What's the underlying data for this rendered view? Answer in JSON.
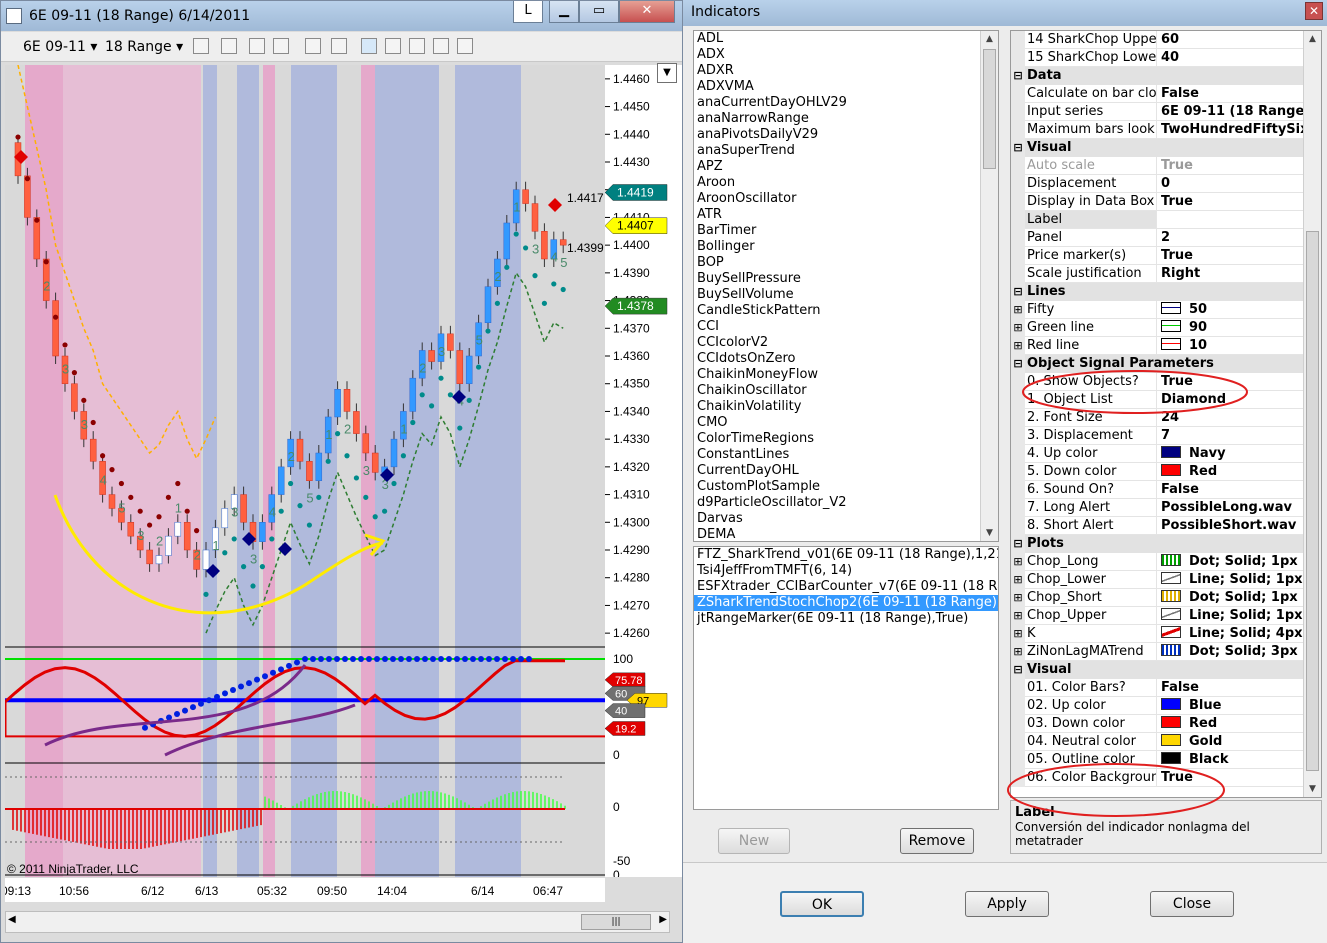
{
  "chart_window": {
    "title": "6E 09-11 (18 Range)  6/14/2011",
    "btn_l": "L",
    "instrument": "6E 09-11",
    "interval": "18 Range",
    "copyright": "© 2011 NinjaTrader, LLC",
    "price_ticks": [
      "1.4460",
      "1.4450",
      "1.4440",
      "1.4430",
      "1.4420",
      "1.4410",
      "1.4400",
      "1.4390",
      "1.4380",
      "1.4370",
      "1.4360",
      "1.4350",
      "1.4340",
      "1.4330",
      "1.4320",
      "1.4310",
      "1.4300",
      "1.4290",
      "1.4280",
      "1.4270",
      "1.4260"
    ],
    "price_markers": [
      {
        "label": "1.4419",
        "color": "#008080",
        "text_color": "#ffffff"
      },
      {
        "label": "1.4407",
        "color": "#ffff00",
        "text_color": "#000000"
      },
      {
        "label": "1.4378",
        "color": "#228b22",
        "text_color": "#ffffff"
      }
    ],
    "price_labels": [
      "1.4417",
      "1.4399"
    ],
    "osc_ticks": [
      "100",
      "0"
    ],
    "osc_markers": [
      {
        "label": "75.78",
        "color": "#e00000",
        "text_color": "#ffffff"
      },
      {
        "label": "60",
        "color": "#707070",
        "text_color": "#ffffff"
      },
      {
        "label": "97",
        "color": "#ffd700",
        "text_color": "#000000"
      },
      {
        "label": "40",
        "color": "#707070",
        "text_color": "#ffffff"
      },
      {
        "label": "19.2",
        "color": "#e00000",
        "text_color": "#ffffff"
      }
    ],
    "hist_ticks": [
      "0",
      "-50",
      "0"
    ],
    "time_labels": [
      "09:13",
      "10:56",
      "6/12",
      "6/13",
      "05:32",
      "09:50",
      "14:04",
      "6/14",
      "06:47"
    ],
    "bar_numbers": [
      "2",
      "3",
      "3",
      "4",
      "5",
      "3",
      "2",
      "1",
      "2",
      "1",
      "3",
      "3",
      "4",
      "2",
      "5",
      "1",
      "2",
      "3",
      "3",
      "1",
      "2",
      "3",
      "4",
      "5",
      "2",
      "1",
      "3",
      "4",
      "5"
    ]
  },
  "dialog": {
    "title": "Indicators",
    "close": "✕",
    "indicators": [
      "ADL",
      "ADX",
      "ADXR",
      "ADXVMA",
      "anaCurrentDayOHLV29",
      "anaNarrowRange",
      "anaPivotsDailyV29",
      "anaSuperTrend",
      "APZ",
      "Aroon",
      "AroonOscillator",
      "ATR",
      "BarTimer",
      "Bollinger",
      "BOP",
      "BuySellPressure",
      "BuySellVolume",
      "CandleStickPattern",
      "CCI",
      "CCIcolorV2",
      "CCIdotsOnZero",
      "ChaikinMoneyFlow",
      "ChaikinOscillator",
      "ChaikinVolatility",
      "CMO",
      "ColorTimeRegions",
      "ConstantLines",
      "CurrentDayOHL",
      "CustomPlotSample",
      "d9ParticleOscillator_V2",
      "Darvas",
      "DEMA"
    ],
    "applied": [
      {
        "label": "FTZ_SharkTrend_v01(6E 09-11 (18 Range),1,21,Ze",
        "selected": false
      },
      {
        "label": "Tsi4JeffFromTMFT(6, 14)",
        "selected": false
      },
      {
        "label": "ESFXtrader_CCIBarCounter_v7(6E 09-11 (18 Range",
        "selected": false
      },
      {
        "label": "ZSharkTrendStochChop2(6E 09-11 (18 Range),3,4,",
        "selected": true
      },
      {
        "label": "jtRangeMarker(6E 09-11 (18 Range),True)",
        "selected": false
      }
    ],
    "new_button": "New",
    "remove_button": "Remove",
    "properties": [
      {
        "kind": "prop",
        "name": "14 SharkChop Upper",
        "value": "60"
      },
      {
        "kind": "prop",
        "name": "15 SharkChop Lower",
        "value": "40"
      },
      {
        "kind": "cat",
        "name": "Data"
      },
      {
        "kind": "prop",
        "name": "Calculate on bar close",
        "value": "False"
      },
      {
        "kind": "prop",
        "name": "Input series",
        "value": "6E 09-11 (18 Range)"
      },
      {
        "kind": "prop",
        "name": "Maximum bars look ba",
        "value": "TwoHundredFiftySix"
      },
      {
        "kind": "cat",
        "name": "Visual"
      },
      {
        "kind": "prop",
        "name": "Auto scale",
        "value": "True",
        "dim": true
      },
      {
        "kind": "prop",
        "name": "Displacement",
        "value": "0"
      },
      {
        "kind": "prop",
        "name": "Display in Data Box",
        "value": "True"
      },
      {
        "kind": "prop",
        "name": "Label",
        "value": "",
        "shaded": true
      },
      {
        "kind": "prop",
        "name": "Panel",
        "value": "2"
      },
      {
        "kind": "prop",
        "name": "Price marker(s)",
        "value": "True"
      },
      {
        "kind": "prop",
        "name": "Scale justification",
        "value": "Right"
      },
      {
        "kind": "cat",
        "name": "Lines"
      },
      {
        "kind": "prop",
        "name": "Fifty",
        "value": "50",
        "expand": true,
        "swatch": "line-navy"
      },
      {
        "kind": "prop",
        "name": "Green line",
        "value": "90",
        "expand": true,
        "swatch": "line-green"
      },
      {
        "kind": "prop",
        "name": "Red line",
        "value": "10",
        "expand": true,
        "swatch": "line-red"
      },
      {
        "kind": "cat",
        "name": "Object Signal Parameters"
      },
      {
        "kind": "prop",
        "name": "0. Show Objects?",
        "value": "True"
      },
      {
        "kind": "prop",
        "name": "1. Object List",
        "value": "Diamond"
      },
      {
        "kind": "prop",
        "name": "2. Font Size",
        "value": "24"
      },
      {
        "kind": "prop",
        "name": "3. Displacement",
        "value": "7"
      },
      {
        "kind": "prop",
        "name": "4. Up color",
        "value": "Navy",
        "swatch": "#000080"
      },
      {
        "kind": "prop",
        "name": "5. Down color",
        "value": "Red",
        "swatch": "#ff0000"
      },
      {
        "kind": "prop",
        "name": "6. Sound On?",
        "value": "False"
      },
      {
        "kind": "prop",
        "name": "7. Long Alert",
        "value": "PossibleLong.wav"
      },
      {
        "kind": "prop",
        "name": "8. Short Alert",
        "value": "PossibleShort.wav"
      },
      {
        "kind": "cat",
        "name": "Plots"
      },
      {
        "kind": "prop",
        "name": "Chop_Long",
        "value": "Dot; Solid; 1px",
        "expand": true,
        "swatch": "plot-bar-green"
      },
      {
        "kind": "prop",
        "name": "Chop_Lower",
        "value": "Line; Solid; 1px",
        "expand": true,
        "swatch": "plot-line-gray"
      },
      {
        "kind": "prop",
        "name": "Chop_Short",
        "value": "Dot; Solid; 1px",
        "expand": true,
        "swatch": "plot-bar-gold"
      },
      {
        "kind": "prop",
        "name": "Chop_Upper",
        "value": "Line; Solid; 1px",
        "expand": true,
        "swatch": "plot-line-gray"
      },
      {
        "kind": "prop",
        "name": "K",
        "value": "Line; Solid; 4px",
        "expand": true,
        "swatch": "plot-line-red"
      },
      {
        "kind": "prop",
        "name": "ZiNonLagMATrend",
        "value": "Dot; Solid; 3px",
        "expand": true,
        "swatch": "plot-bar-blue"
      },
      {
        "kind": "cat",
        "name": "Visual"
      },
      {
        "kind": "prop",
        "name": "01. Color Bars?",
        "value": "False"
      },
      {
        "kind": "prop",
        "name": "02. Up color",
        "value": "Blue",
        "swatch": "#0000ff"
      },
      {
        "kind": "prop",
        "name": "03. Down color",
        "value": "Red",
        "swatch": "#ff0000"
      },
      {
        "kind": "prop",
        "name": "04. Neutral color",
        "value": "Gold",
        "swatch": "#ffd700"
      },
      {
        "kind": "prop",
        "name": "05. Outline color",
        "value": "Black",
        "swatch": "#000000"
      },
      {
        "kind": "prop",
        "name": "06. Color Background",
        "value": "True"
      }
    ],
    "desc_title": "Label",
    "desc_text": "Conversión del indicador nonlagma del metatrader",
    "ok_button": "OK",
    "apply_button": "Apply",
    "close_button": "Close"
  },
  "colors": {
    "accent": "#3399ff",
    "pink_band": "#e6a0c8",
    "blue_band": "#a8b4dc",
    "annotation": "#e02020",
    "highlight": "#ffeb00"
  }
}
